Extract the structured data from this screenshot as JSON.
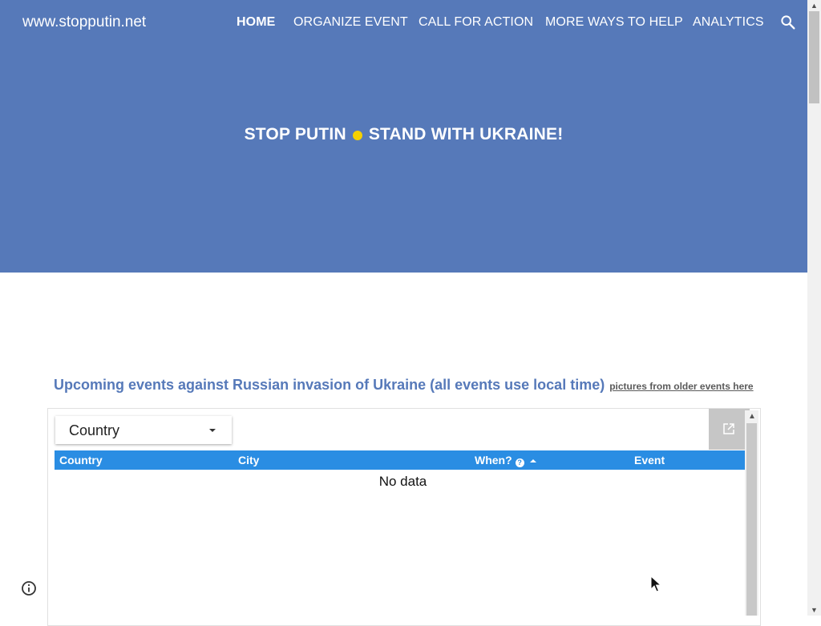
{
  "site": {
    "title": "www.stopputin.net"
  },
  "nav": {
    "items": [
      {
        "label": "HOME",
        "active": true
      },
      {
        "label": "ORGANIZE EVENT",
        "active": false
      },
      {
        "label": "CALL FOR ACTION",
        "active": false
      },
      {
        "label": "MORE WAYS TO HELP",
        "active": false
      },
      {
        "label": "ANALYTICS",
        "active": false
      }
    ],
    "search_icon": "search-icon"
  },
  "hero": {
    "headline_left": "STOP PUTIN",
    "headline_right": "STAND WITH UKRAINE!",
    "dot_color": "#f4d000",
    "background": "#5679b9"
  },
  "section": {
    "heading": "Upcoming events against Russian invasion of Ukraine (all events use local time)",
    "link": "pictures from older events here"
  },
  "events_table": {
    "filter_label": "Country",
    "open_icon": "open-in-new-icon",
    "columns": [
      "Country",
      "City",
      "When?",
      "Event"
    ],
    "sorted_column": "When?",
    "sort_direction": "ascending",
    "empty_text": "No data",
    "header_color": "#2a8de3"
  },
  "footer": {
    "info_icon": "info-icon"
  }
}
